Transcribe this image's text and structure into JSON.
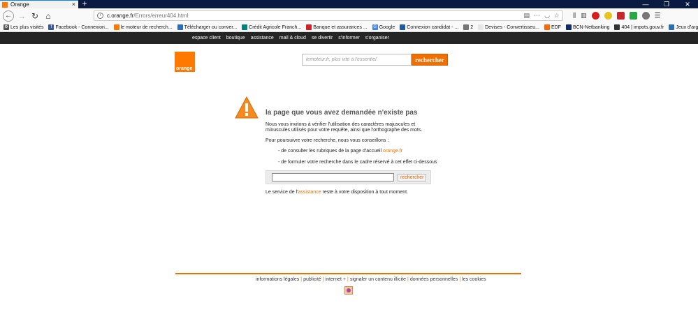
{
  "browser": {
    "tab_title": "Orange",
    "tab_close": "×",
    "new_tab": "+",
    "win_controls": [
      "—",
      "❐",
      "✕"
    ],
    "url_host": "c.orange.fr",
    "url_path": "/Errors/erreur404.html",
    "url_actions": [
      "⋯",
      "☆"
    ]
  },
  "bookmarks": [
    {
      "label": "Les plus visités",
      "color": "#555555",
      "glyph": "⚙"
    },
    {
      "label": "Facebook - Connexion...",
      "color": "#3b5998",
      "glyph": "f"
    },
    {
      "label": "le moteur de recherch...",
      "color": "#ff7900",
      "glyph": ""
    },
    {
      "label": "Télécharger ou conver...",
      "color": "#2a6ebb",
      "glyph": ""
    },
    {
      "label": "Crédit Agricole Franch...",
      "color": "#00857a",
      "glyph": ""
    },
    {
      "label": "Banque et assurances ...",
      "color": "#d61f26",
      "glyph": ""
    },
    {
      "label": "Google",
      "color": "#4285f4",
      "glyph": "G"
    },
    {
      "label": "Connexion candidat - ...",
      "color": "#1f5aa6",
      "glyph": ""
    },
    {
      "label": "2",
      "color": "#777777",
      "glyph": ""
    },
    {
      "label": "Devises - Convertisseu...",
      "color": "#e6e6e6",
      "glyph": ""
    },
    {
      "label": "EDF",
      "color": "#ff6600",
      "glyph": ""
    },
    {
      "label": "BCN-Netbanking",
      "color": "#0d2c6c",
      "glyph": ""
    },
    {
      "label": "404 | impots.gouv.fr",
      "color": "#333333",
      "glyph": ""
    },
    {
      "label": "Jeux d'argent en ligne,...",
      "color": "#2a6ebb",
      "glyph": ""
    }
  ],
  "site": {
    "nav": [
      "espace client",
      "boutique",
      "assistance",
      "mail & cloud",
      "se divertir",
      "s'informer",
      "s'organiser"
    ],
    "logo_text": "orange",
    "search_placeholder": "lemoteur.fr, plus vite à l'essentiel",
    "search_button": "rechercher",
    "error_title": "la page que vous avez demandée n'existe pas",
    "msg1": "Nous vous invitons à vérifier l'utilisation des caractères majuscules et minuscules utilisés pour votre requête, ainsi que l'orthographe des mots.",
    "msg2": "Pour poursuivre votre recherche, nous vous conseillons :",
    "bullet1_prefix": "- de consulter les rubriques de la page d'accueil ",
    "bullet1_link": "orange.fr",
    "bullet2": "- de formuler votre recherche dans le cadre réservé à cet effet ci-dessous",
    "search2_button": "rechercher",
    "service_prefix": "Le service de l'",
    "service_link": "assistance",
    "service_suffix": " reste à votre disposition à tout moment.",
    "footer_links": [
      "informations légales",
      "publicité",
      "internet +",
      "signaler un contenu illicite",
      "données personnelles",
      "les cookies"
    ]
  },
  "colors": {
    "orange": "#ff7900",
    "dark_nav": "#252525"
  }
}
